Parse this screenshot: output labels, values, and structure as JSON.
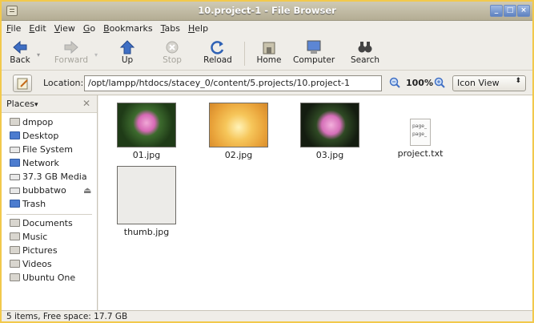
{
  "window": {
    "title": "10.project-1 - File Browser"
  },
  "menu": [
    "File",
    "Edit",
    "View",
    "Go",
    "Bookmarks",
    "Tabs",
    "Help"
  ],
  "toolbar": {
    "back": "Back",
    "forward": "Forward",
    "up": "Up",
    "stop": "Stop",
    "reload": "Reload",
    "home": "Home",
    "computer": "Computer",
    "search": "Search"
  },
  "location": {
    "label": "Location:",
    "path": "/opt/lampp/htdocs/stacey_0/content/5.projects/10.project-1",
    "zoom": "100%",
    "view_mode": "Icon View"
  },
  "sidebar": {
    "header": "Places",
    "items": [
      "dmpop",
      "Desktop",
      "File System",
      "Network",
      "37.3 GB Media",
      "bubbatwo",
      "Trash"
    ],
    "bookmarks": [
      "Documents",
      "Music",
      "Pictures",
      "Videos",
      "Ubuntu One"
    ]
  },
  "files": [
    {
      "name": "01.jpg"
    },
    {
      "name": "02.jpg"
    },
    {
      "name": "03.jpg"
    },
    {
      "name": "project.txt",
      "preview": [
        "page_",
        "page_"
      ]
    },
    {
      "name": "thumb.jpg"
    }
  ],
  "status": "5 items, Free space: 17.7 GB",
  "colors": {
    "frame": "#f2c94c",
    "accent": "#4c7ccf"
  }
}
